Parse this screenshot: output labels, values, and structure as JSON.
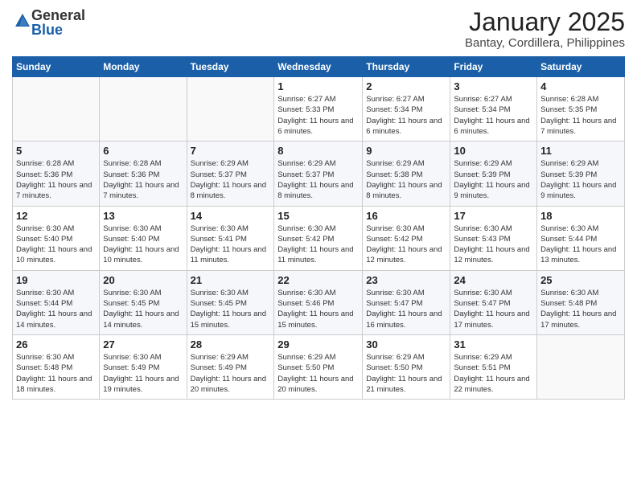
{
  "header": {
    "logo_general": "General",
    "logo_blue": "Blue",
    "month_title": "January 2025",
    "location": "Bantay, Cordillera, Philippines"
  },
  "weekdays": [
    "Sunday",
    "Monday",
    "Tuesday",
    "Wednesday",
    "Thursday",
    "Friday",
    "Saturday"
  ],
  "weeks": [
    [
      {
        "day": "",
        "info": ""
      },
      {
        "day": "",
        "info": ""
      },
      {
        "day": "",
        "info": ""
      },
      {
        "day": "1",
        "info": "Sunrise: 6:27 AM\nSunset: 5:33 PM\nDaylight: 11 hours and 6 minutes."
      },
      {
        "day": "2",
        "info": "Sunrise: 6:27 AM\nSunset: 5:34 PM\nDaylight: 11 hours and 6 minutes."
      },
      {
        "day": "3",
        "info": "Sunrise: 6:27 AM\nSunset: 5:34 PM\nDaylight: 11 hours and 6 minutes."
      },
      {
        "day": "4",
        "info": "Sunrise: 6:28 AM\nSunset: 5:35 PM\nDaylight: 11 hours and 7 minutes."
      }
    ],
    [
      {
        "day": "5",
        "info": "Sunrise: 6:28 AM\nSunset: 5:36 PM\nDaylight: 11 hours and 7 minutes."
      },
      {
        "day": "6",
        "info": "Sunrise: 6:28 AM\nSunset: 5:36 PM\nDaylight: 11 hours and 7 minutes."
      },
      {
        "day": "7",
        "info": "Sunrise: 6:29 AM\nSunset: 5:37 PM\nDaylight: 11 hours and 8 minutes."
      },
      {
        "day": "8",
        "info": "Sunrise: 6:29 AM\nSunset: 5:37 PM\nDaylight: 11 hours and 8 minutes."
      },
      {
        "day": "9",
        "info": "Sunrise: 6:29 AM\nSunset: 5:38 PM\nDaylight: 11 hours and 8 minutes."
      },
      {
        "day": "10",
        "info": "Sunrise: 6:29 AM\nSunset: 5:39 PM\nDaylight: 11 hours and 9 minutes."
      },
      {
        "day": "11",
        "info": "Sunrise: 6:29 AM\nSunset: 5:39 PM\nDaylight: 11 hours and 9 minutes."
      }
    ],
    [
      {
        "day": "12",
        "info": "Sunrise: 6:30 AM\nSunset: 5:40 PM\nDaylight: 11 hours and 10 minutes."
      },
      {
        "day": "13",
        "info": "Sunrise: 6:30 AM\nSunset: 5:40 PM\nDaylight: 11 hours and 10 minutes."
      },
      {
        "day": "14",
        "info": "Sunrise: 6:30 AM\nSunset: 5:41 PM\nDaylight: 11 hours and 11 minutes."
      },
      {
        "day": "15",
        "info": "Sunrise: 6:30 AM\nSunset: 5:42 PM\nDaylight: 11 hours and 11 minutes."
      },
      {
        "day": "16",
        "info": "Sunrise: 6:30 AM\nSunset: 5:42 PM\nDaylight: 11 hours and 12 minutes."
      },
      {
        "day": "17",
        "info": "Sunrise: 6:30 AM\nSunset: 5:43 PM\nDaylight: 11 hours and 12 minutes."
      },
      {
        "day": "18",
        "info": "Sunrise: 6:30 AM\nSunset: 5:44 PM\nDaylight: 11 hours and 13 minutes."
      }
    ],
    [
      {
        "day": "19",
        "info": "Sunrise: 6:30 AM\nSunset: 5:44 PM\nDaylight: 11 hours and 14 minutes."
      },
      {
        "day": "20",
        "info": "Sunrise: 6:30 AM\nSunset: 5:45 PM\nDaylight: 11 hours and 14 minutes."
      },
      {
        "day": "21",
        "info": "Sunrise: 6:30 AM\nSunset: 5:45 PM\nDaylight: 11 hours and 15 minutes."
      },
      {
        "day": "22",
        "info": "Sunrise: 6:30 AM\nSunset: 5:46 PM\nDaylight: 11 hours and 15 minutes."
      },
      {
        "day": "23",
        "info": "Sunrise: 6:30 AM\nSunset: 5:47 PM\nDaylight: 11 hours and 16 minutes."
      },
      {
        "day": "24",
        "info": "Sunrise: 6:30 AM\nSunset: 5:47 PM\nDaylight: 11 hours and 17 minutes."
      },
      {
        "day": "25",
        "info": "Sunrise: 6:30 AM\nSunset: 5:48 PM\nDaylight: 11 hours and 17 minutes."
      }
    ],
    [
      {
        "day": "26",
        "info": "Sunrise: 6:30 AM\nSunset: 5:48 PM\nDaylight: 11 hours and 18 minutes."
      },
      {
        "day": "27",
        "info": "Sunrise: 6:30 AM\nSunset: 5:49 PM\nDaylight: 11 hours and 19 minutes."
      },
      {
        "day": "28",
        "info": "Sunrise: 6:29 AM\nSunset: 5:49 PM\nDaylight: 11 hours and 20 minutes."
      },
      {
        "day": "29",
        "info": "Sunrise: 6:29 AM\nSunset: 5:50 PM\nDaylight: 11 hours and 20 minutes."
      },
      {
        "day": "30",
        "info": "Sunrise: 6:29 AM\nSunset: 5:50 PM\nDaylight: 11 hours and 21 minutes."
      },
      {
        "day": "31",
        "info": "Sunrise: 6:29 AM\nSunset: 5:51 PM\nDaylight: 11 hours and 22 minutes."
      },
      {
        "day": "",
        "info": ""
      }
    ]
  ]
}
